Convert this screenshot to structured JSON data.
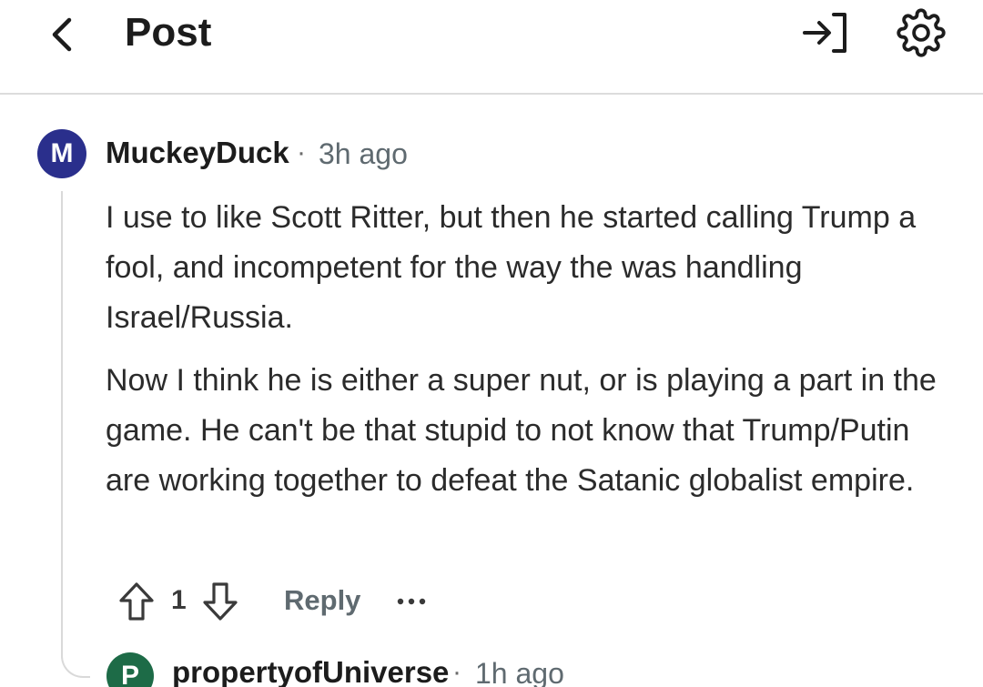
{
  "header": {
    "title": "Post",
    "back_icon": "chevron-left-icon",
    "login_icon": "login-arrow-icon",
    "settings_icon": "gear-icon"
  },
  "comment": {
    "avatar_letter": "M",
    "avatar_color": "#2a2f8c",
    "username": "MuckeyDuck",
    "separator": "·",
    "time": "3h ago",
    "paragraphs": [
      "I use to like Scott Ritter, but then he started calling Trump a fool, and incompetent for the way the was handling Israel/Russia.",
      "Now I think he is either a super nut, or is playing a part in the game. He can't be that stupid to not know that Trump/Putin are working together to defeat the Satanic globalist empire."
    ],
    "score": "1",
    "reply_label": "Reply",
    "more_icon": "more-dots-icon"
  },
  "reply": {
    "avatar_letter": "P",
    "avatar_color": "#1d6b47",
    "username": "propertyofUniverse",
    "separator": "·",
    "time": "1h ago"
  }
}
